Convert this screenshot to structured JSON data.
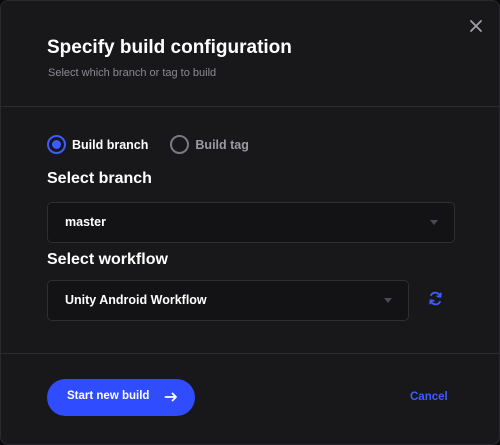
{
  "dialog": {
    "title": "Specify build configuration",
    "subtitle": "Select which branch or tag to build",
    "close_icon": "close-icon"
  },
  "source_type": {
    "options": [
      {
        "label": "Build branch",
        "selected": true
      },
      {
        "label": "Build tag",
        "selected": false
      }
    ]
  },
  "branch": {
    "label": "Select branch",
    "value": "master"
  },
  "workflow": {
    "label": "Select workflow",
    "value": "Unity Android Workflow",
    "refresh_icon": "refresh-icon"
  },
  "footer": {
    "start_label": "Start new build",
    "start_icon": "arrow-right-icon",
    "cancel_label": "Cancel"
  },
  "colors": {
    "accent": "#2f4cff",
    "background": "#18181b",
    "muted_text": "#8a8a93"
  }
}
